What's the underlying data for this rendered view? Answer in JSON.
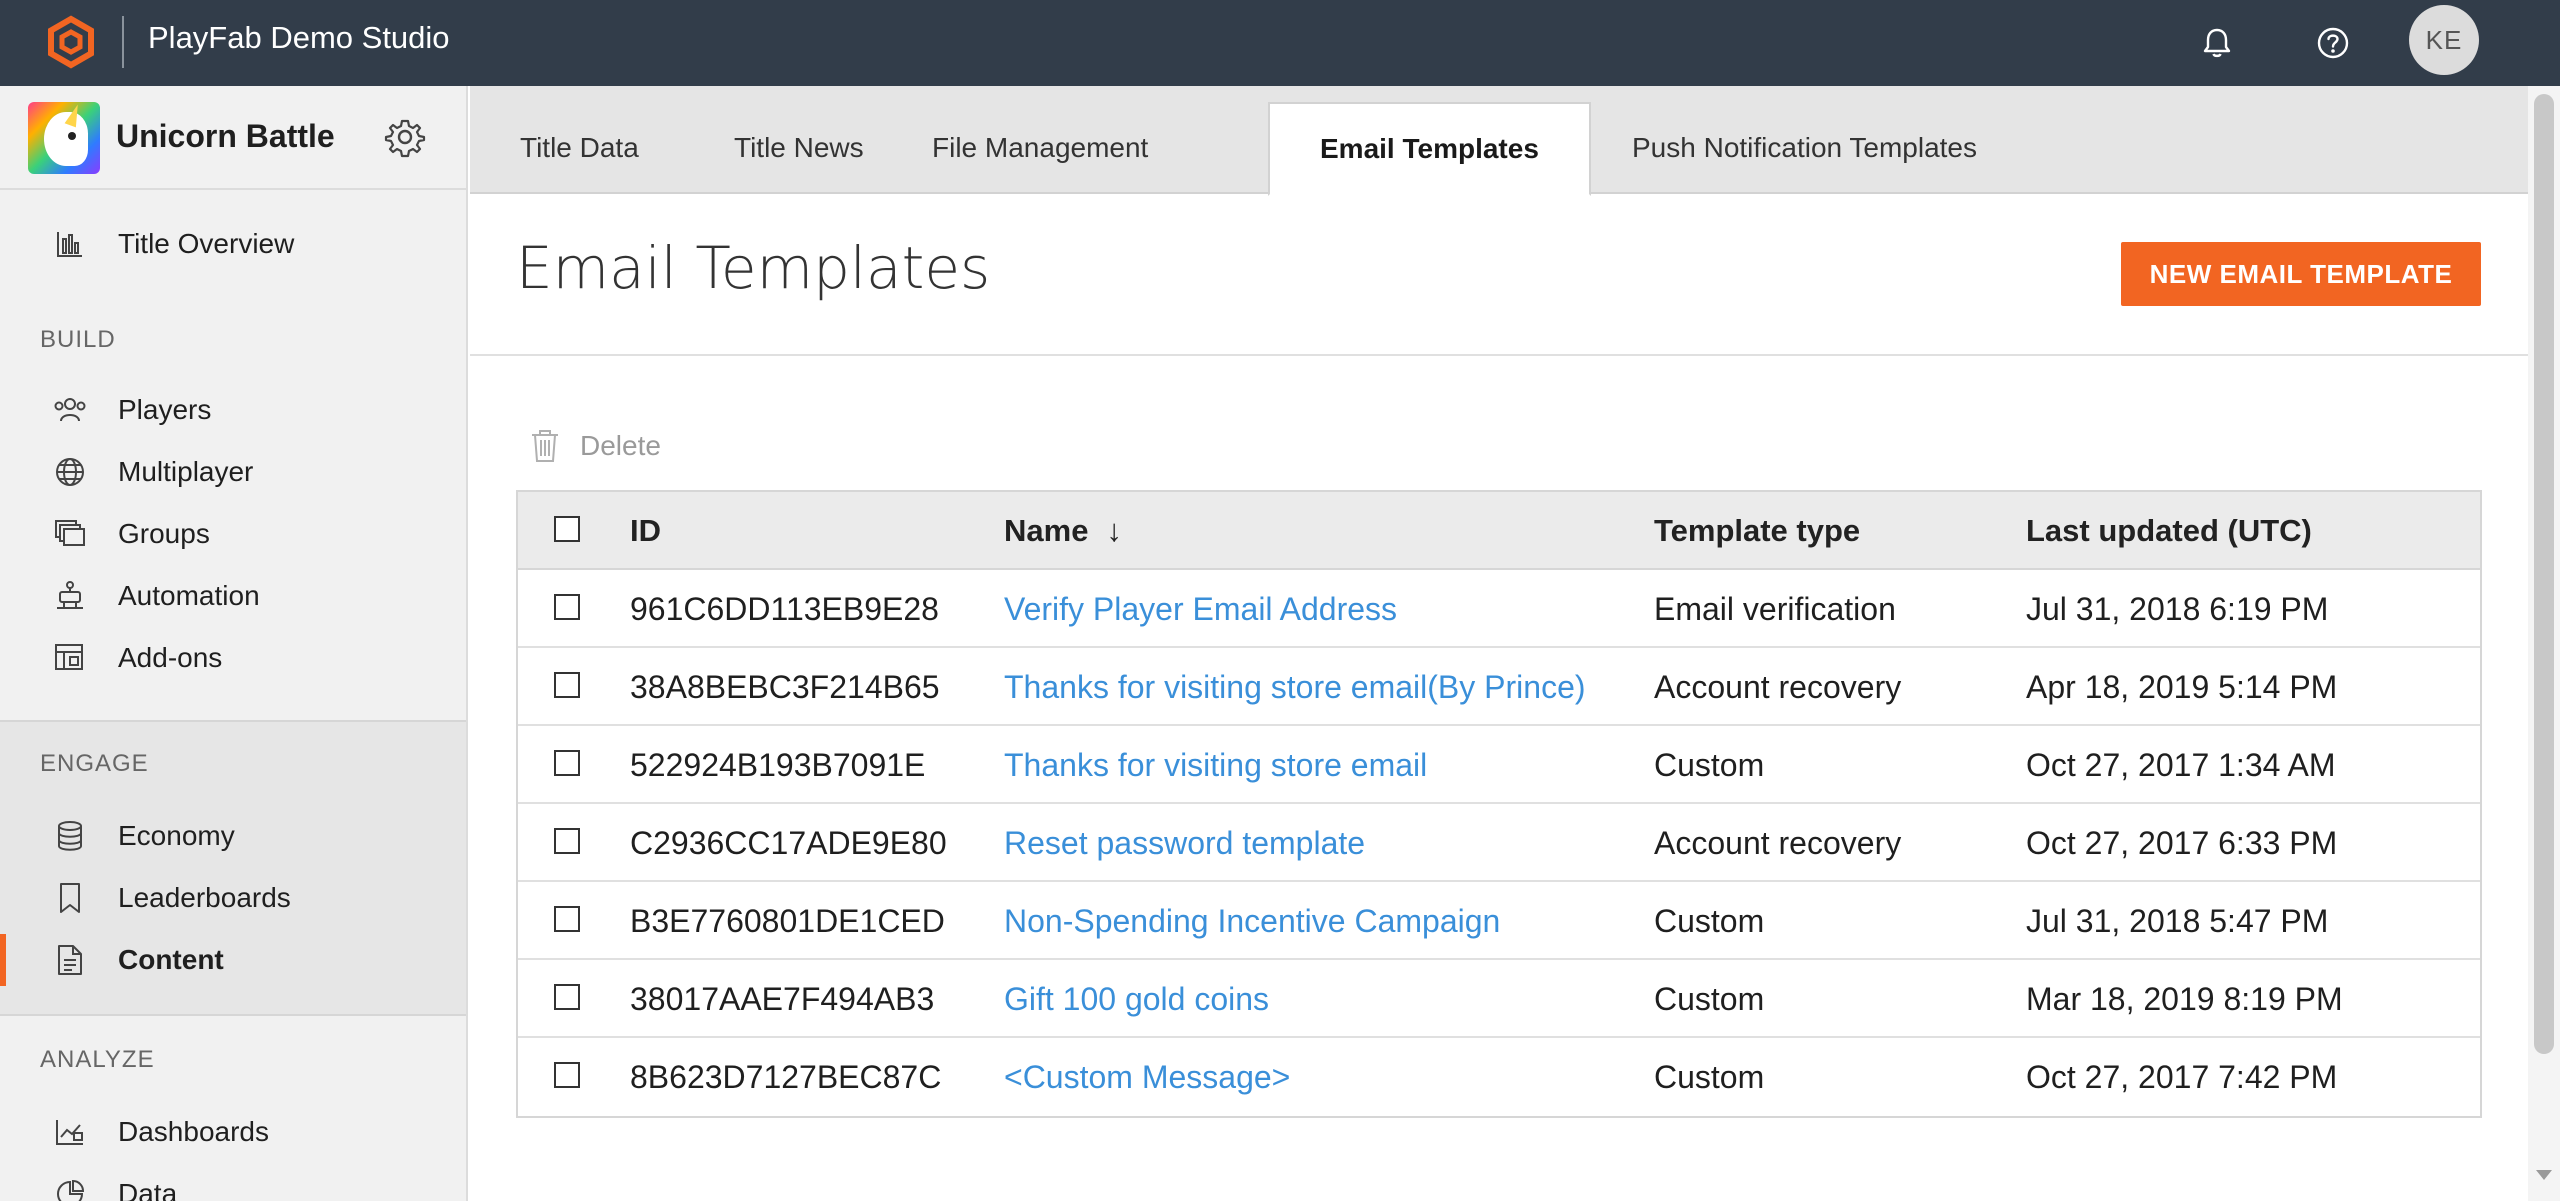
{
  "topbar": {
    "studio_name": "PlayFab Demo Studio",
    "avatar_initials": "KE",
    "icons": [
      "playfab-logo-icon",
      "bell-icon",
      "help-icon"
    ]
  },
  "sidebar": {
    "game_name": "Unicorn Battle",
    "overview_label": "Title Overview",
    "sections": {
      "build": "BUILD",
      "engage": "ENGAGE",
      "analyze": "ANALYZE"
    },
    "build_items": [
      "Players",
      "Multiplayer",
      "Groups",
      "Automation",
      "Add-ons"
    ],
    "engage_items": [
      "Economy",
      "Leaderboards",
      "Content"
    ],
    "analyze_items": [
      "Dashboards",
      "Data"
    ],
    "active_item": "Content",
    "accent_color": "#f26522"
  },
  "tabs": [
    "Title Data",
    "Title News",
    "File Management",
    "Email Templates",
    "Push Notification Templates"
  ],
  "active_tab": "Email Templates",
  "page": {
    "title": "Email Templates",
    "new_button_label": "NEW EMAIL TEMPLATE",
    "delete_label": "Delete"
  },
  "table": {
    "columns": {
      "id": "ID",
      "name": "Name",
      "name_sort_icon": "↓",
      "type": "Template type",
      "date": "Last updated (UTC)"
    },
    "rows": [
      {
        "id": "961C6DD113EB9E28",
        "name": "Verify Player Email Address",
        "type": "Email verification",
        "date": "Jul 31, 2018 6:19 PM"
      },
      {
        "id": "38A8BEBC3F214B65",
        "name": "Thanks for visiting store email(By Prince)",
        "type": "Account recovery",
        "date": "Apr 18, 2019 5:14 PM"
      },
      {
        "id": "522924B193B7091E",
        "name": "Thanks for visiting store email",
        "type": "Custom",
        "date": "Oct 27, 2017 1:34 AM"
      },
      {
        "id": "C2936CC17ADE9E80",
        "name": "Reset password template",
        "type": "Account recovery",
        "date": "Oct 27, 2017 6:33 PM"
      },
      {
        "id": "B3E7760801DE1CED",
        "name": "Non-Spending Incentive Campaign",
        "type": "Custom",
        "date": "Jul 31, 2018 5:47 PM"
      },
      {
        "id": "38017AAE7F494AB3",
        "name": "Gift 100 gold coins",
        "type": "Custom",
        "date": "Mar 18, 2019 8:19 PM"
      },
      {
        "id": "8B623D7127BEC87C",
        "name": "<Custom Message>",
        "type": "Custom",
        "date": "Oct 27, 2017 7:42 PM"
      }
    ]
  }
}
